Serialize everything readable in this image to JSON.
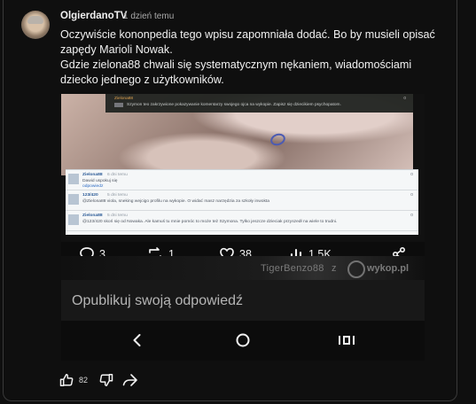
{
  "comment": {
    "author": "OlgierdanoTV",
    "time": "1 dzień temu",
    "lines": [
      "Oczywiście kononpedia tego wpisu zapomniała dodać. Bo by musieli opisać",
      "zapędy Marioli Nowak.",
      "Gdzie zielona88 chwali się systematycznym nękaniem, wiadomościami",
      "dziecko jednego z użytkowników."
    ],
    "likes": "82"
  },
  "image": {
    "overlay_user": "Zielona88",
    "overlay_message": "Szymon teo zakrzywione pokazywanie komentarzy swojego ojca na wykopie. Zapisz się dziecikiem psychopatom.",
    "overlay_count": "0",
    "comments": [
      {
        "author": "Zielona88",
        "meta": "6 dni temu",
        "text": "Dawid uspokuj się",
        "link": "odpowiedz",
        "count": "0"
      },
      {
        "author": "123/420",
        "meta": "5 dni temu",
        "text": "@Zielona88  viola, sneking wejcigo profilu na wykopie. O widać masz narzędzia za szkoły inwokta",
        "link": "",
        "count": "0"
      },
      {
        "author": "Zielona88",
        "meta": "5 dni temu",
        "text": "@123/420  skoń się od Nowaka. Ale kamuś tu mnie pomóc to może też Szymona. Tylko jeszcze dzieciak przyszedł na wiele to trudni.",
        "link": "",
        "count": "0"
      }
    ],
    "stats": {
      "replies": "3",
      "reposts": "1",
      "likes": "38",
      "views": "1,5K"
    },
    "watermark_left": "TigerBenzo88",
    "watermark_z": "z",
    "watermark_right": "wykop.pl",
    "reply_placeholder": "Opublikuj swoją odpowiedź"
  }
}
